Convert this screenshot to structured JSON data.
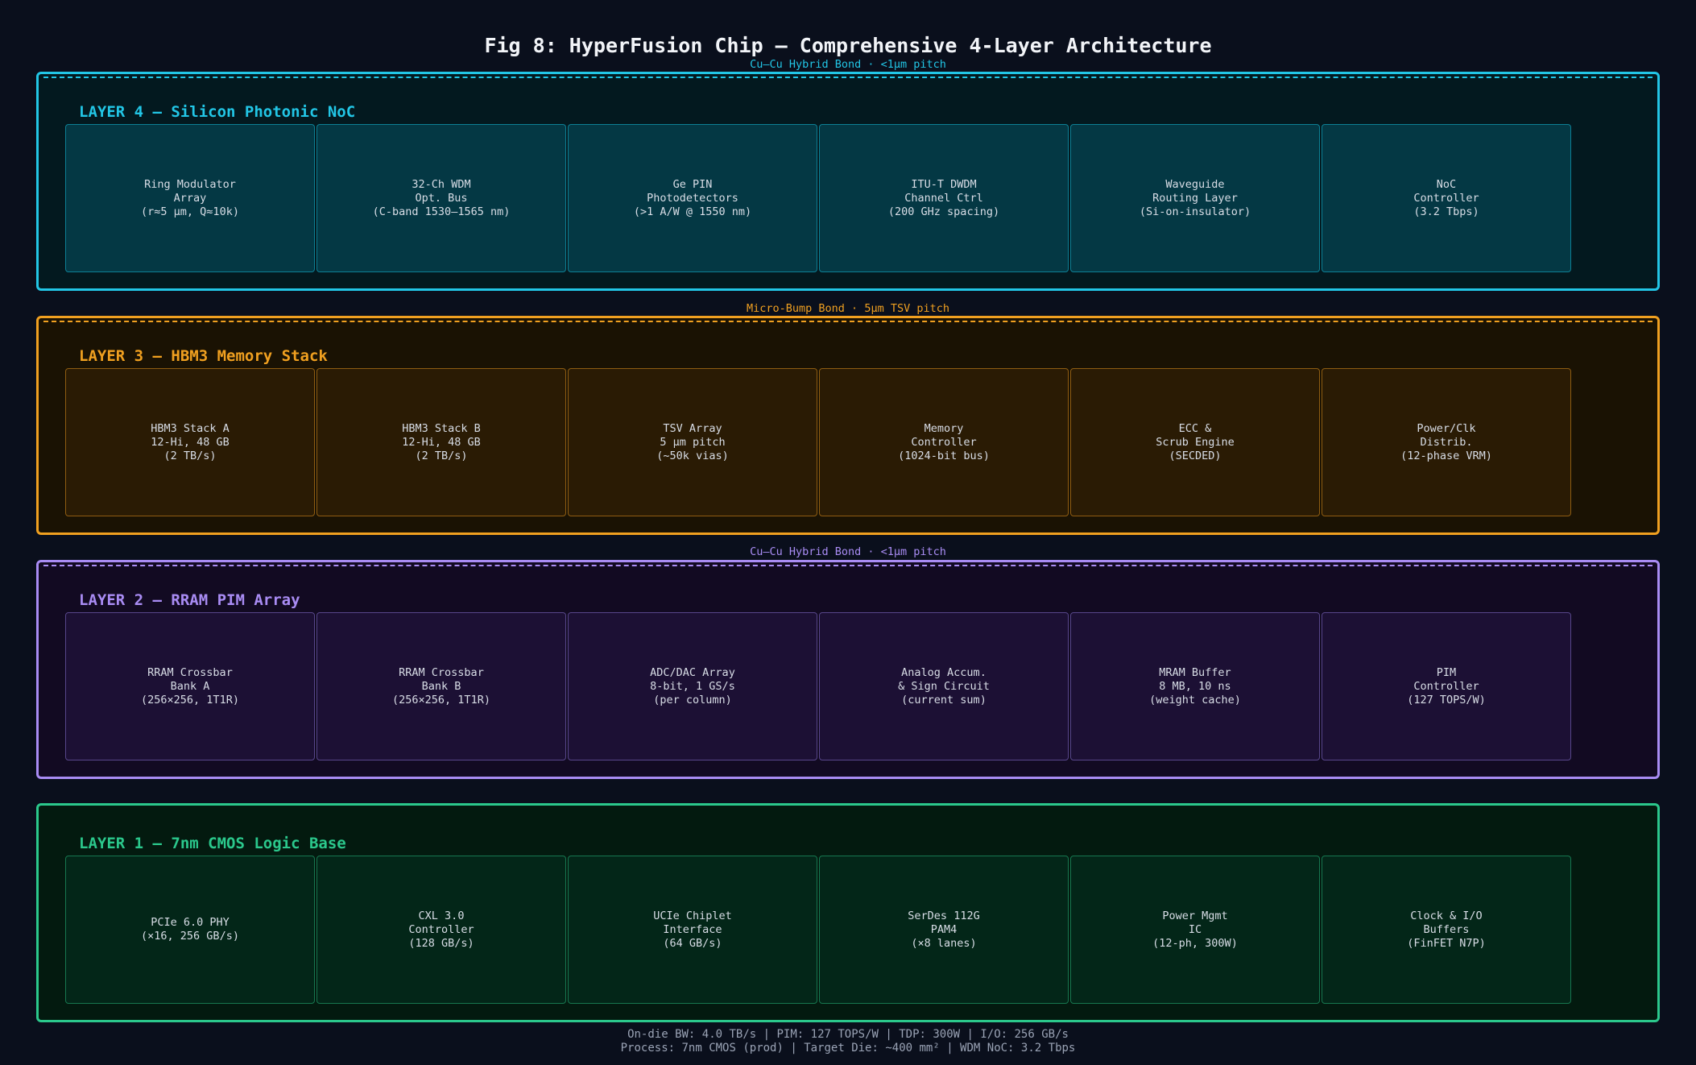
{
  "title": "Fig 8: HyperFusion Chip — Comprehensive 4-Layer Architecture",
  "bonds": [
    "Cu–Cu Hybrid Bond · <1μm pitch",
    "Micro-Bump Bond · 5μm TSV pitch",
    "Cu–Cu Hybrid Bond · <1μm pitch"
  ],
  "layers": [
    {
      "title": "LAYER 4 — Silicon Photonic NoC",
      "color": "#22c6e6",
      "blocks": [
        "Ring Modulator\nArray\n(r≈5 μm, Q≈10k)",
        "32-Ch WDM\nOpt. Bus\n(C-band 1530–1565 nm)",
        "Ge PIN\nPhotodetectors\n(>1 A/W @ 1550 nm)",
        "ITU-T DWDM\nChannel Ctrl\n(200 GHz spacing)",
        "Waveguide\nRouting Layer\n(Si-on-insulator)",
        "NoC\nController\n(3.2 Tbps)"
      ]
    },
    {
      "title": "LAYER 3 — HBM3 Memory Stack",
      "color": "#f0a020",
      "blocks": [
        "HBM3 Stack A\n12-Hi, 48 GB\n(2 TB/s)",
        "HBM3 Stack B\n12-Hi, 48 GB\n(2 TB/s)",
        "TSV Array\n5 μm pitch\n(~50k vias)",
        "Memory\nController\n(1024-bit bus)",
        "ECC &\nScrub Engine\n(SECDED)",
        "Power/Clk\nDistrib.\n(12-phase VRM)"
      ]
    },
    {
      "title": "LAYER 2 — RRAM PIM Array",
      "color": "#a98cf4",
      "blocks": [
        "RRAM Crossbar\nBank A\n(256×256, 1T1R)",
        "RRAM Crossbar\nBank B\n(256×256, 1T1R)",
        "ADC/DAC Array\n8-bit, 1 GS/s\n(per column)",
        "Analog Accum.\n& Sign Circuit\n(current sum)",
        "MRAM Buffer\n8 MB, 10 ns\n(weight cache)",
        "PIM\nController\n(127 TOPS/W)"
      ]
    },
    {
      "title": "LAYER 1 — 7nm CMOS Logic Base",
      "color": "#2bc88c",
      "blocks": [
        "PCIe 6.0 PHY\n(×16, 256 GB/s)",
        "CXL 3.0\nController\n(128 GB/s)",
        "UCIe Chiplet\nInterface\n(64 GB/s)",
        "SerDes 112G\nPAM4\n(×8 lanes)",
        "Power Mgmt\nIC\n(12-ph, 300W)",
        "Clock & I/O\nBuffers\n(FinFET N7P)"
      ]
    }
  ],
  "footer": [
    "On-die BW: 4.0 TB/s  |  PIM: 127 TOPS/W  |  TDP: 300W  |  I/O: 256 GB/s",
    "Process: 7nm CMOS (prod)  |  Target Die: ~400 mm²  |  WDM NoC: 3.2 Tbps"
  ]
}
